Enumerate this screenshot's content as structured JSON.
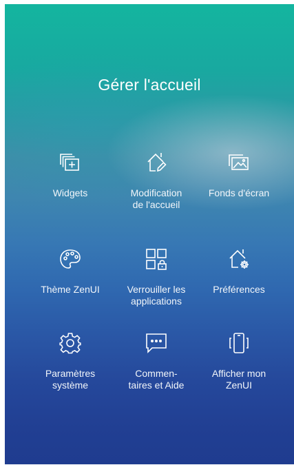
{
  "header": {
    "title": "Gérer l'accueil"
  },
  "tiles": [
    {
      "label": "Widgets",
      "icon": "widgets-icon"
    },
    {
      "label": "Modification\nde l'accueil",
      "icon": "edit-home-icon"
    },
    {
      "label": "Fonds d'écran",
      "icon": "wallpaper-icon"
    },
    {
      "label": "Thème ZenUI",
      "icon": "palette-icon"
    },
    {
      "label": "Verrouiller les\napplications",
      "icon": "app-lock-icon"
    },
    {
      "label": "Préférences",
      "icon": "home-settings-icon"
    },
    {
      "label": "Paramètres\nsystème",
      "icon": "gear-icon"
    },
    {
      "label": "Commen-\ntaires et Aide",
      "icon": "feedback-icon"
    },
    {
      "label": "Afficher mon\nZenUI",
      "icon": "phone-vibrate-icon"
    }
  ],
  "colors": {
    "gradient_top": "#14b59f",
    "gradient_bottom": "#1f3c8f",
    "text": "#ffffff"
  }
}
